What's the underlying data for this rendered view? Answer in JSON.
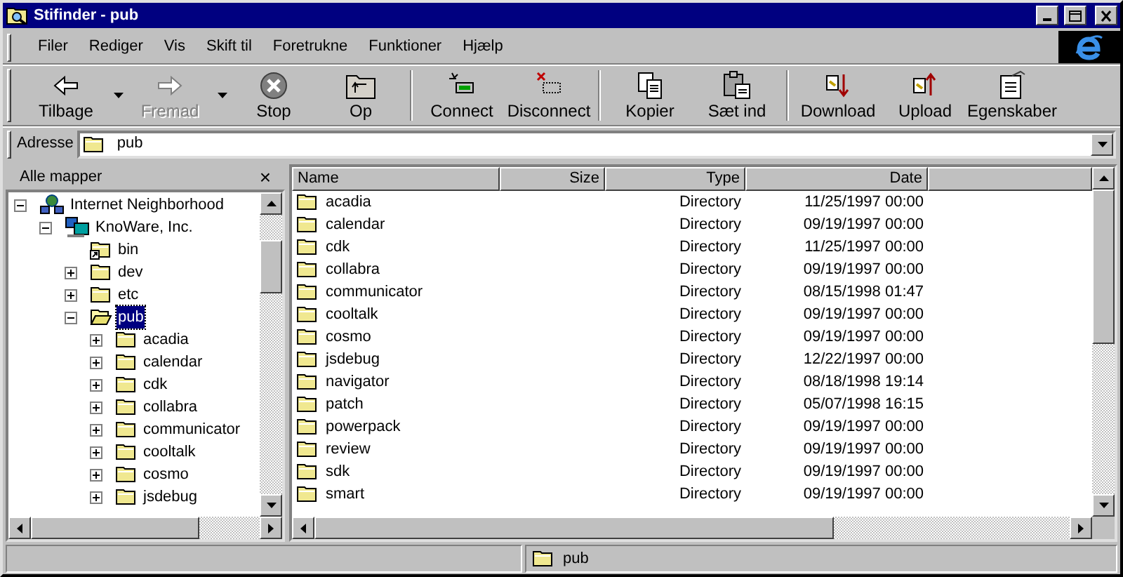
{
  "window": {
    "title": "Stifinder - pub"
  },
  "menu": [
    "Filer",
    "Rediger",
    "Vis",
    "Skift til",
    "Foretrukne",
    "Funktioner",
    "Hjælp"
  ],
  "toolbar": [
    [
      {
        "label": "Tilbage",
        "disabled": false,
        "dropdown": true
      },
      {
        "label": "Fremad",
        "disabled": true,
        "dropdown": true
      },
      {
        "label": "Stop",
        "disabled": false,
        "dropdown": false
      },
      {
        "label": "Op",
        "disabled": false,
        "dropdown": false
      }
    ],
    [
      {
        "label": "Connect",
        "disabled": false,
        "dropdown": false
      },
      {
        "label": "Disconnect",
        "disabled": false,
        "dropdown": false
      }
    ],
    [
      {
        "label": "Kopier",
        "disabled": false,
        "dropdown": false
      },
      {
        "label": "Sæt ind",
        "disabled": false,
        "dropdown": false
      }
    ],
    [
      {
        "label": "Download",
        "disabled": false,
        "dropdown": false
      },
      {
        "label": "Upload",
        "disabled": false,
        "dropdown": false
      },
      {
        "label": "Egenskaber",
        "disabled": false,
        "dropdown": false
      }
    ]
  ],
  "address": {
    "label": "Adresse",
    "value": "pub"
  },
  "tree_pane": {
    "title": "Alle mapper",
    "close": "×"
  },
  "tree": [
    {
      "label": "Internet Neighborhood",
      "kind": "network",
      "expanded": true,
      "selected": false,
      "children": [
        {
          "label": "KnoWare, Inc.",
          "kind": "computer",
          "expanded": true,
          "selected": false,
          "children": [
            {
              "label": "bin",
              "kind": "shortcut",
              "selected": false
            },
            {
              "label": "dev",
              "kind": "folder",
              "expanded": false,
              "selected": false
            },
            {
              "label": "etc",
              "kind": "folder",
              "expanded": false,
              "selected": false
            },
            {
              "label": "pub",
              "kind": "folder",
              "expanded": true,
              "selected": true,
              "children": [
                {
                  "label": "acadia",
                  "kind": "folder",
                  "expanded": false,
                  "selected": false
                },
                {
                  "label": "calendar",
                  "kind": "folder",
                  "expanded": false,
                  "selected": false
                },
                {
                  "label": "cdk",
                  "kind": "folder",
                  "expanded": false,
                  "selected": false
                },
                {
                  "label": "collabra",
                  "kind": "folder",
                  "expanded": false,
                  "selected": false
                },
                {
                  "label": "communicator",
                  "kind": "folder",
                  "expanded": false,
                  "selected": false
                },
                {
                  "label": "cooltalk",
                  "kind": "folder",
                  "expanded": false,
                  "selected": false
                },
                {
                  "label": "cosmo",
                  "kind": "folder",
                  "expanded": false,
                  "selected": false
                },
                {
                  "label": "jsdebug",
                  "kind": "folder",
                  "expanded": false,
                  "selected": false
                }
              ]
            }
          ]
        }
      ]
    }
  ],
  "table": {
    "columns": [
      "Name",
      "Size",
      "Type",
      "Date"
    ],
    "rows": [
      {
        "name": "acadia",
        "type": "Directory",
        "date": "11/25/1997 00:00"
      },
      {
        "name": "calendar",
        "type": "Directory",
        "date": "09/19/1997 00:00"
      },
      {
        "name": "cdk",
        "type": "Directory",
        "date": "11/25/1997 00:00"
      },
      {
        "name": "collabra",
        "type": "Directory",
        "date": "09/19/1997 00:00"
      },
      {
        "name": "communicator",
        "type": "Directory",
        "date": "08/15/1998 01:47"
      },
      {
        "name": "cooltalk",
        "type": "Directory",
        "date": "09/19/1997 00:00"
      },
      {
        "name": "cosmo",
        "type": "Directory",
        "date": "09/19/1997 00:00"
      },
      {
        "name": "jsdebug",
        "type": "Directory",
        "date": "12/22/1997 00:00"
      },
      {
        "name": "navigator",
        "type": "Directory",
        "date": "08/18/1998 19:14"
      },
      {
        "name": "patch",
        "type": "Directory",
        "date": "05/07/1998 16:15"
      },
      {
        "name": "powerpack",
        "type": "Directory",
        "date": "09/19/1997 00:00"
      },
      {
        "name": "review",
        "type": "Directory",
        "date": "09/19/1997 00:00"
      },
      {
        "name": "sdk",
        "type": "Directory",
        "date": "09/19/1997 00:00"
      },
      {
        "name": "smart",
        "type": "Directory",
        "date": "09/19/1997 00:00"
      }
    ]
  },
  "status_bar": {
    "location": "pub"
  }
}
